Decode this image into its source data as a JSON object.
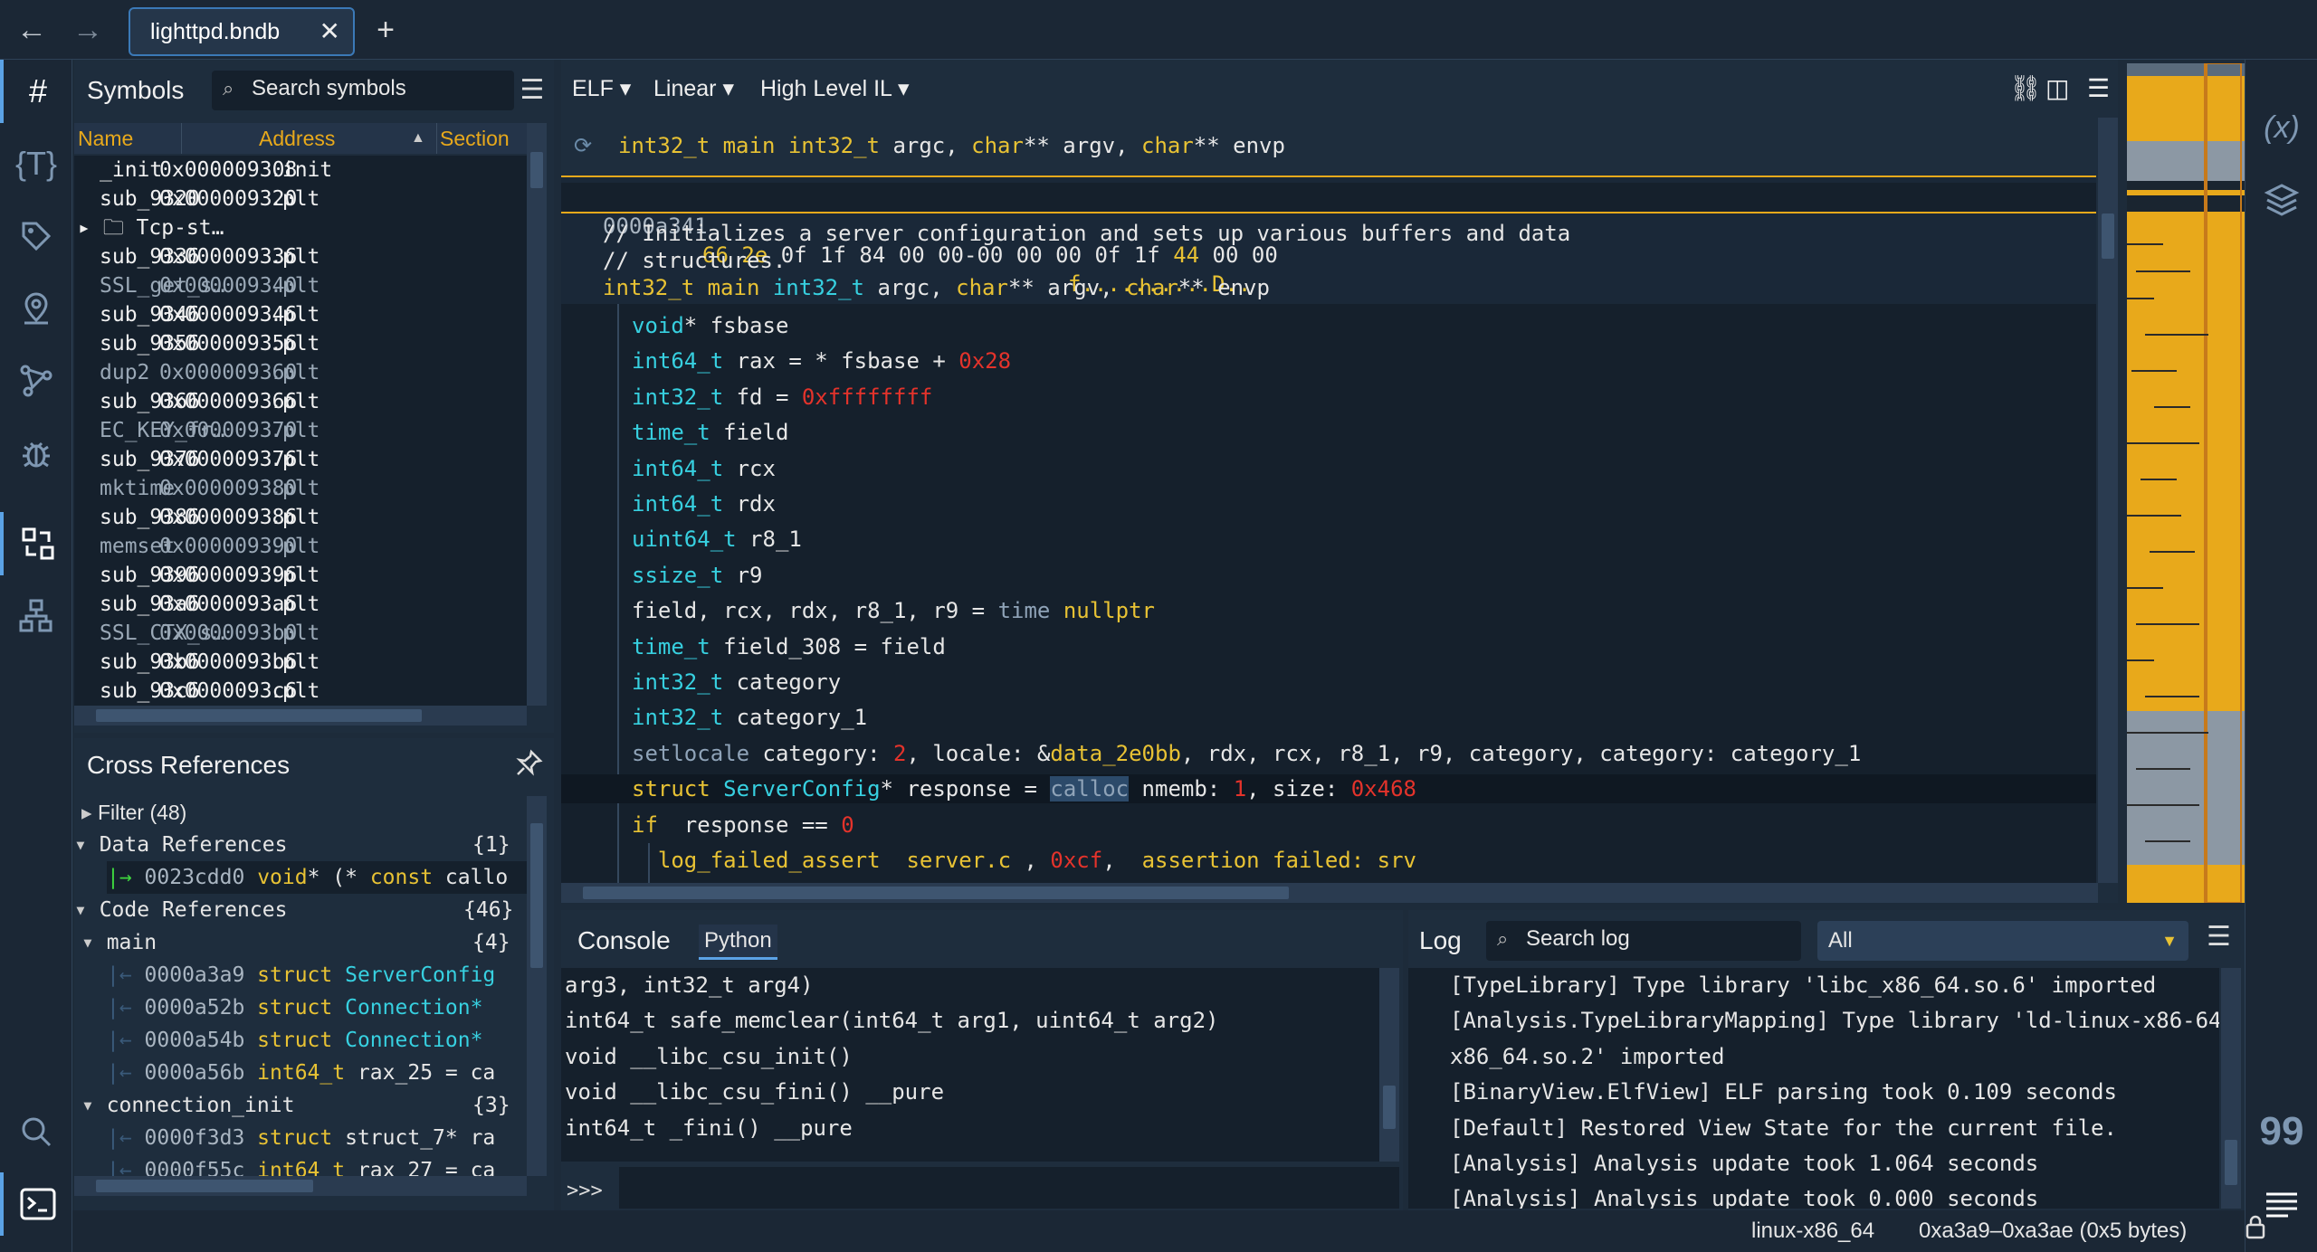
{
  "nav": {
    "back": "←",
    "forward": "→",
    "new_tab": "+"
  },
  "tab": {
    "title": "lighttpd.bndb",
    "close": "✕"
  },
  "symbols": {
    "title": "Symbols",
    "search_placeholder": "Search symbols",
    "columns": [
      "Name",
      "Address",
      "Section"
    ],
    "rows": [
      {
        "name": "_init",
        "addr": "0x000009308",
        "sec": ".init",
        "dim": false
      },
      {
        "name": "sub_9320",
        "addr": "0x000009320",
        "sec": ".plt",
        "dim": false
      },
      {
        "name": "Tcp-st…",
        "addr": "",
        "sec": "",
        "dim": false,
        "folder": true
      },
      {
        "name": "sub_9336",
        "addr": "0x000009336",
        "sec": ".plt",
        "dim": false
      },
      {
        "name": "SSL_get_s…",
        "addr": "0x000009340",
        "sec": ".plt",
        "dim": true
      },
      {
        "name": "sub_9346",
        "addr": "0x000009346",
        "sec": ".plt",
        "dim": false
      },
      {
        "name": "sub_9356",
        "addr": "0x000009356",
        "sec": ".plt",
        "dim": false
      },
      {
        "name": "dup2",
        "addr": "0x000009360",
        "sec": ".plt",
        "dim": true
      },
      {
        "name": "sub_9366",
        "addr": "0x000009366",
        "sec": ".plt",
        "dim": false
      },
      {
        "name": "EC_KEY_fr…",
        "addr": "0x000009370",
        "sec": ".plt",
        "dim": true
      },
      {
        "name": "sub_9376",
        "addr": "0x000009376",
        "sec": ".plt",
        "dim": false
      },
      {
        "name": "mktime",
        "addr": "0x000009380",
        "sec": ".plt",
        "dim": true
      },
      {
        "name": "sub_9386",
        "addr": "0x000009386",
        "sec": ".plt",
        "dim": false
      },
      {
        "name": "memset",
        "addr": "0x000009390",
        "sec": ".plt",
        "dim": true
      },
      {
        "name": "sub_9396",
        "addr": "0x000009396",
        "sec": ".plt",
        "dim": false
      },
      {
        "name": "sub_93a6",
        "addr": "0x0000093a6",
        "sec": ".plt",
        "dim": false
      },
      {
        "name": "SSL_CTX_s…",
        "addr": "0x0000093b0",
        "sec": ".plt",
        "dim": true
      },
      {
        "name": "sub_93b6",
        "addr": "0x0000093b6",
        "sec": ".plt",
        "dim": false
      },
      {
        "name": "sub_93c6",
        "addr": "0x0000093c6",
        "sec": ".plt",
        "dim": false
      }
    ]
  },
  "xrefs": {
    "title": "Cross References",
    "filter": "Filter (48)",
    "data_refs": {
      "label": "Data References",
      "count": "{1}"
    },
    "data_row": {
      "addr": "0023cdd0",
      "text": "void* (* const callo"
    },
    "code_refs": {
      "label": "Code References",
      "count": "{46}"
    },
    "groups": [
      {
        "name": "main",
        "count": "{4}",
        "rows": [
          {
            "addr": "0000a3a9",
            "t1": "struct ",
            "t2": "ServerConfig"
          },
          {
            "addr": "0000a52b",
            "t1": "struct ",
            "t2": "Connection*"
          },
          {
            "addr": "0000a54b",
            "t1": "struct ",
            "t2": "Connection*"
          },
          {
            "addr": "0000a56b",
            "t1": "int64_t ",
            "t2": "rax_25 = ca"
          }
        ]
      },
      {
        "name": "connection_init",
        "count": "{3}",
        "rows": [
          {
            "addr": "0000f3d3",
            "t1": "struct ",
            "t2": "struct_7* ra"
          },
          {
            "addr": "0000f55c",
            "t1": "int64_t ",
            "t2": "rax_27 = ca"
          }
        ]
      }
    ]
  },
  "code": {
    "toolbar": {
      "format": "ELF ▾",
      "layout": "Linear ▾",
      "il": "High Level IL ▾"
    },
    "sig_line": [
      "int32_t main int32_t ",
      "argc",
      ", ",
      "char",
      "** argv, ",
      "char",
      "** envp"
    ],
    "hex": {
      "addr": "0000a341",
      "bytes": "66 2e 0f 1f 84 00 00-00 00 00 0f 1f 44 00 00",
      "ascii": "f..........D.."
    },
    "comment1": "// Initializes a server configuration and sets up various buffers and data",
    "comment2": "// structures.",
    "decl": [
      "int32_t main ",
      "int32_t",
      " argc, ",
      "char",
      "** argv, ",
      "char",
      "** envp"
    ],
    "lines": [
      [
        [
          "ty",
          "void"
        ],
        [
          "cm",
          "* fsbase"
        ]
      ],
      [
        [
          "ty",
          "int64_t"
        ],
        [
          "cm",
          " rax = * fsbase + "
        ],
        [
          "num",
          "0x28"
        ]
      ],
      [
        [
          "ty",
          "int32_t"
        ],
        [
          "cm",
          " fd = "
        ],
        [
          "num",
          "0xffffffff"
        ]
      ],
      [
        [
          "ty",
          "time_t"
        ],
        [
          "cm",
          " field"
        ]
      ],
      [
        [
          "ty",
          "int64_t"
        ],
        [
          "cm",
          " rcx"
        ]
      ],
      [
        [
          "ty",
          "int64_t"
        ],
        [
          "cm",
          " rdx"
        ]
      ],
      [
        [
          "ty",
          "uint64_t"
        ],
        [
          "cm",
          " r8_1"
        ]
      ],
      [
        [
          "ty",
          "ssize_t"
        ],
        [
          "cm",
          " r9"
        ]
      ],
      [
        [
          "cm",
          "field, rcx, rdx, r8_1, r9 = "
        ],
        [
          "gr",
          "time "
        ],
        [
          "kw",
          "nullptr"
        ]
      ],
      [
        [
          "ty",
          "time_t"
        ],
        [
          "cm",
          " field_308 = field"
        ]
      ],
      [
        [
          "ty",
          "int32_t"
        ],
        [
          "cm",
          " category"
        ]
      ],
      [
        [
          "ty",
          "int32_t"
        ],
        [
          "cm",
          " category_1"
        ]
      ],
      [
        [
          "gr",
          "setlocale"
        ],
        [
          "cm",
          " category: "
        ],
        [
          "num",
          "2"
        ],
        [
          "cm",
          ", locale: &"
        ],
        [
          "dat",
          "data_2e0bb"
        ],
        [
          "cm",
          ", rdx, rcx, r8_1, r9, category, category: category_1"
        ]
      ],
      [
        [
          "kw",
          "struct "
        ],
        [
          "ty",
          "ServerConfig"
        ],
        [
          "cm",
          "* response = "
        ],
        [
          "gr",
          "calloc"
        ],
        [
          "cm",
          " nmemb: "
        ],
        [
          "num",
          "1"
        ],
        [
          "cm",
          ", size: "
        ],
        [
          "num",
          "0x468"
        ]
      ],
      [
        [
          "kw",
          "if"
        ],
        [
          "cm",
          "  response == "
        ],
        [
          "num",
          "0"
        ]
      ],
      [
        [
          "kw",
          "  log_failed_assert"
        ],
        [
          "cm",
          "  "
        ],
        [
          "str",
          "server.c"
        ],
        [
          "cm",
          " , "
        ],
        [
          "num",
          "0xcf"
        ],
        [
          "cm",
          ",  "
        ],
        [
          "str",
          "assertion failed: srv"
        ]
      ]
    ]
  },
  "console": {
    "tab1": "Console",
    "tab2": "Python",
    "prompt": ">>>",
    "lines": [
      "arg3, int32_t arg4)",
      "int64_t safe_memclear(int64_t arg1, uint64_t arg2)",
      "void __libc_csu_init()",
      "void __libc_csu_fini() __pure",
      "int64_t _fini() __pure"
    ]
  },
  "log": {
    "title": "Log",
    "search_placeholder": "Search log",
    "level": "All",
    "lines": [
      "[TypeLibrary] Type library 'libc_x86_64.so.6' imported",
      "[Analysis.TypeLibraryMapping] Type library 'ld-linux-x86-64_",
      "x86_64.so.2' imported",
      "[BinaryView.ElfView] ELF parsing took 0.109 seconds",
      "[Default] Restored View State for the current file.",
      "[Analysis] Analysis update took 1.064 seconds",
      "[Analysis] Analysis update took 0.000 seconds"
    ]
  },
  "status": {
    "platform": "linux-x86_64",
    "selection": "0xa3a9–0xa3ae (0x5 bytes)"
  }
}
